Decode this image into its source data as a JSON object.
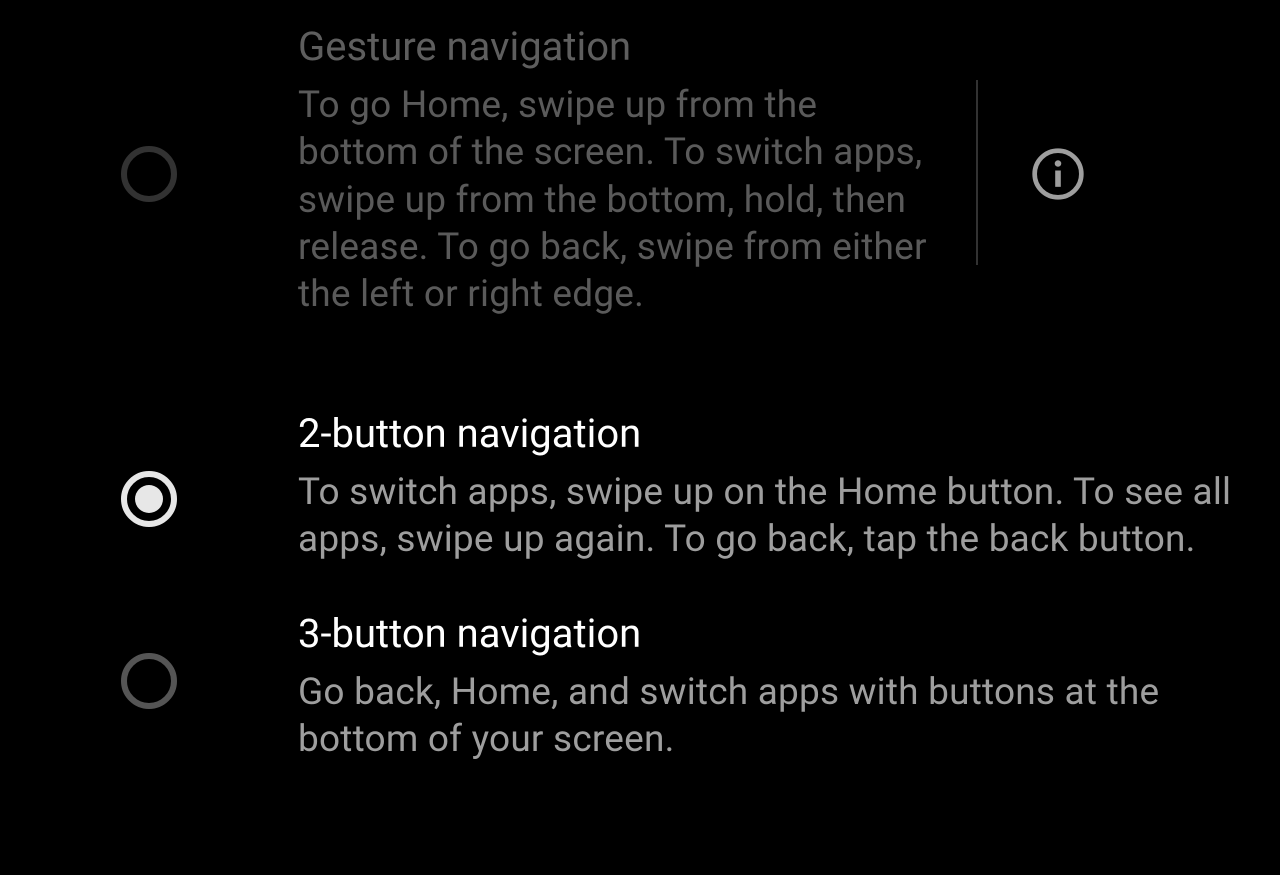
{
  "options": {
    "gesture": {
      "title": "Gesture navigation",
      "desc": "To go Home, swipe up from the bottom of the screen. To switch apps, swipe up from the bottom, hold, then release. To go back, swipe from either the left or right edge.",
      "selected": false,
      "dimmed": true,
      "showInfo": true
    },
    "two_button": {
      "title": "2-button navigation",
      "desc": "To switch apps, swipe up on the Home button. To see all apps, swipe up again. To go back, tap the back button.",
      "selected": true,
      "dimmed": false,
      "showInfo": false
    },
    "three_button": {
      "title": "3-button navigation",
      "desc": "Go back, Home, and switch apps with buttons at the bottom of your screen.",
      "selected": false,
      "dimmed": false,
      "showInfo": false
    }
  }
}
